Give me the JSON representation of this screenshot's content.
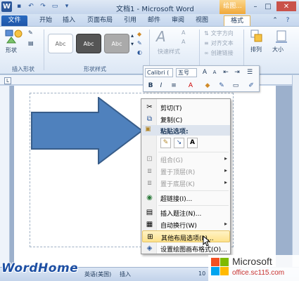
{
  "titlebar": {
    "title": "文档1 - Microsoft Word",
    "contextual_tab": "绘图...",
    "window_controls": [
      "minimize",
      "maximize",
      "close"
    ],
    "qat_icons": [
      "word-icon",
      "save-icon",
      "undo-icon",
      "redo-icon",
      "folder-icon",
      "customize-icon"
    ]
  },
  "tabs": [
    "文件",
    "开始",
    "插入",
    "页面布局",
    "引用",
    "邮件",
    "审阅",
    "视图",
    "格式"
  ],
  "ribbon": {
    "shape_label": "形状",
    "insert_shapes_label": "插入形状",
    "shape_styles_label": "形状样式",
    "style_swatch_text": "Abc",
    "quick_styles_label": "快速样式",
    "text_direction": "文字方向",
    "align_text": "对齐文本",
    "create_link": "创建链接",
    "arrange": "排列",
    "size": "大小"
  },
  "minibar": {
    "font": "Calibri (",
    "size": "五号",
    "buttons_row1": [
      "A↑",
      "A↓",
      "≡",
      "≡",
      "≡"
    ],
    "buttons_row2": [
      "B",
      "I",
      "≡",
      "A",
      "◆",
      "✎",
      "⊥",
      "✔"
    ]
  },
  "context_menu": {
    "items": [
      {
        "label": "剪切(T)",
        "icon": "cut-icon",
        "disabled": false
      },
      {
        "label": "复制(C)",
        "icon": "copy-icon",
        "disabled": false
      },
      {
        "label": "粘贴选项:",
        "icon": "paste-icon",
        "disabled": false
      },
      {
        "label": "组合(G)",
        "icon": "group-icon",
        "disabled": true
      },
      {
        "label": "置于顶层(R)",
        "icon": "bring-front-icon",
        "disabled": true
      },
      {
        "label": "置于底层(K)",
        "icon": "send-back-icon",
        "disabled": true
      },
      {
        "label": "超链接(I)...",
        "icon": "hyperlink-icon",
        "disabled": false
      },
      {
        "label": "插入题注(N)...",
        "icon": "caption-icon",
        "disabled": false
      },
      {
        "label": "自动换行(W)",
        "icon": "wrap-icon",
        "disabled": false
      },
      {
        "label": "其他布局选项(L)...",
        "icon": "layout-icon",
        "disabled": false
      },
      {
        "label": "设置绘图画布格式(O)...",
        "icon": "format-canvas-icon",
        "disabled": false
      }
    ],
    "paste_options": [
      "✎",
      "↘",
      "A"
    ]
  },
  "statusbar": {
    "language": "英语(美国)",
    "mode": "插入",
    "zoom": "10"
  },
  "watermark": {
    "left": "WordHome",
    "brand": "Microsoft",
    "url": "office.sc115.com"
  },
  "colors": {
    "arrow_fill": "#4f81bd",
    "arrow_stroke": "#385d8a",
    "file_tab": "#2a6bc1",
    "highlight": "#fde28c"
  }
}
